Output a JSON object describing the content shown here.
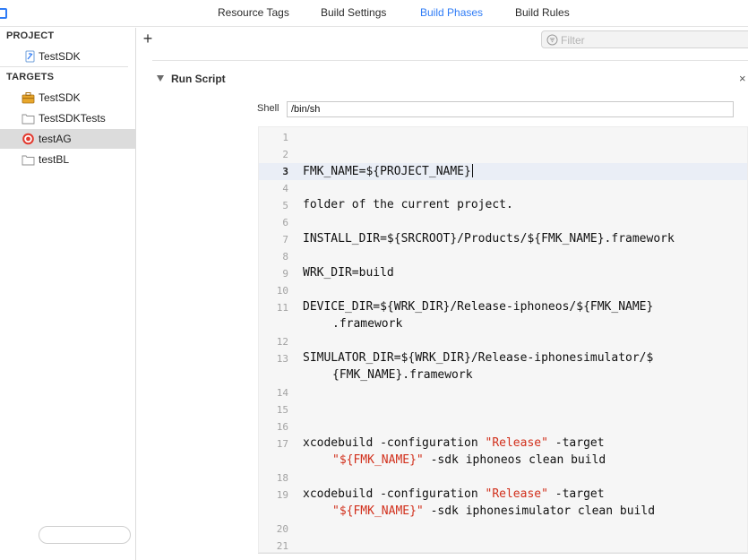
{
  "tabs": [
    {
      "label": "Resource Tags",
      "active": false
    },
    {
      "label": "Build Settings",
      "active": false
    },
    {
      "label": "Build Phases",
      "active": true
    },
    {
      "label": "Build Rules",
      "active": false
    }
  ],
  "sidebar": {
    "project_header": "PROJECT",
    "project_item": {
      "label": "TestSDK",
      "icon": "xcode-project-icon"
    },
    "targets_header": "TARGETS",
    "targets": [
      {
        "label": "TestSDK",
        "icon": "toolbox-icon",
        "selected": false
      },
      {
        "label": "TestSDKTests",
        "icon": "folder-icon",
        "selected": false
      },
      {
        "label": "testAG",
        "icon": "target-icon",
        "selected": true
      },
      {
        "label": "testBL",
        "icon": "folder-icon",
        "selected": false
      }
    ]
  },
  "toolbar": {
    "add_label": "+",
    "filter_placeholder": "Filter"
  },
  "phase": {
    "title": "Run Script",
    "close_label": "×",
    "shell_label": "Shell",
    "shell_value": "/bin/sh"
  },
  "script": {
    "current_line": 3,
    "lines": [
      {
        "n": "1",
        "parts": []
      },
      {
        "n": "2",
        "parts": []
      },
      {
        "n": "3",
        "parts": [
          {
            "t": "FMK_NAME=${PROJECT_NAME}"
          }
        ]
      },
      {
        "n": "4",
        "parts": []
      },
      {
        "n": "5",
        "parts": [
          {
            "t": "folder of the current project."
          }
        ]
      },
      {
        "n": "6",
        "parts": []
      },
      {
        "n": "7",
        "parts": [
          {
            "t": "INSTALL_DIR=${SRCROOT}/Products/${FMK_NAME}.framework"
          }
        ]
      },
      {
        "n": "8",
        "parts": []
      },
      {
        "n": "9",
        "parts": [
          {
            "t": "WRK_DIR=build"
          }
        ]
      },
      {
        "n": "10",
        "parts": []
      },
      {
        "n": "11",
        "parts": [
          {
            "t": "DEVICE_DIR=${WRK_DIR}/Release-iphoneos/${FMK_NAME}"
          }
        ]
      },
      {
        "n": "",
        "cont": true,
        "parts": [
          {
            "t": ".framework"
          }
        ]
      },
      {
        "n": "12",
        "parts": []
      },
      {
        "n": "13",
        "parts": [
          {
            "t": "SIMULATOR_DIR=${WRK_DIR}/Release-iphonesimulator/$"
          }
        ]
      },
      {
        "n": "",
        "cont": true,
        "parts": [
          {
            "t": "{FMK_NAME}.framework"
          }
        ]
      },
      {
        "n": "14",
        "parts": []
      },
      {
        "n": "15",
        "parts": []
      },
      {
        "n": "16",
        "parts": []
      },
      {
        "n": "17",
        "parts": [
          {
            "t": "xcodebuild -configuration "
          },
          {
            "t": "\"Release\"",
            "s": true
          },
          {
            "t": " -target"
          }
        ]
      },
      {
        "n": "",
        "cont": true,
        "parts": [
          {
            "t": "\"${FMK_NAME}\"",
            "s": true
          },
          {
            "t": " -sdk iphoneos clean build"
          }
        ]
      },
      {
        "n": "18",
        "parts": []
      },
      {
        "n": "19",
        "parts": [
          {
            "t": "xcodebuild -configuration "
          },
          {
            "t": "\"Release\"",
            "s": true
          },
          {
            "t": " -target"
          }
        ]
      },
      {
        "n": "",
        "cont": true,
        "parts": [
          {
            "t": "\"${FMK_NAME}\"",
            "s": true
          },
          {
            "t": " -sdk iphonesimulator clean build"
          }
        ]
      },
      {
        "n": "20",
        "parts": []
      },
      {
        "n": "21",
        "parts": []
      }
    ]
  },
  "colors": {
    "accent": "#2f7cf6",
    "string": "#d12f1b",
    "selection": "#dcdcdc"
  }
}
